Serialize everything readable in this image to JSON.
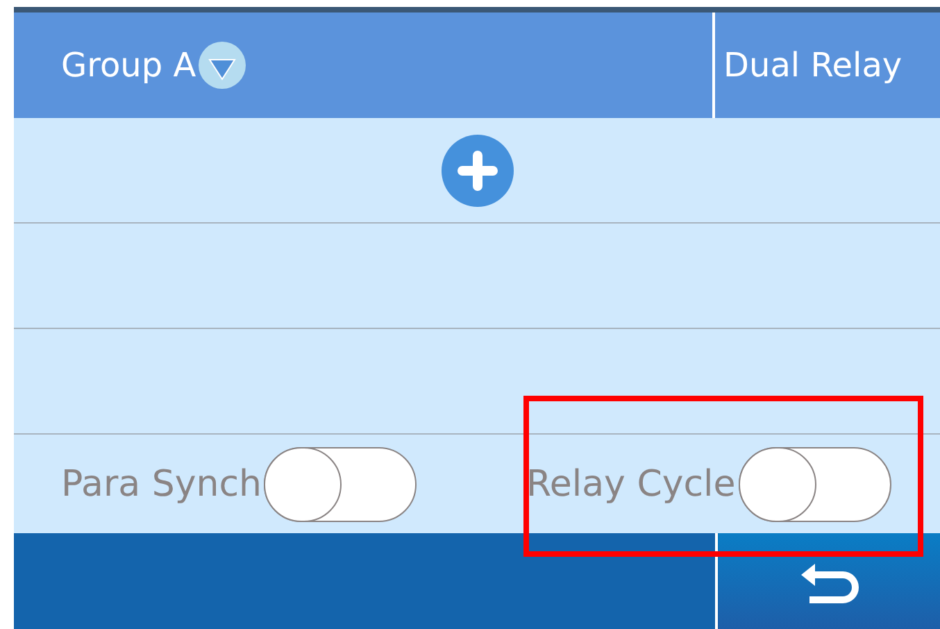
{
  "header": {
    "group": "Group A",
    "mode": "Dual Relay"
  },
  "rows": [
    {
      "kind": "add"
    },
    {
      "kind": "empty"
    },
    {
      "kind": "empty"
    }
  ],
  "toggles": [
    {
      "label": "Para Synch",
      "on": false,
      "highlighted": false
    },
    {
      "label": "Relay Cycle",
      "on": false,
      "highlighted": true
    }
  ]
}
